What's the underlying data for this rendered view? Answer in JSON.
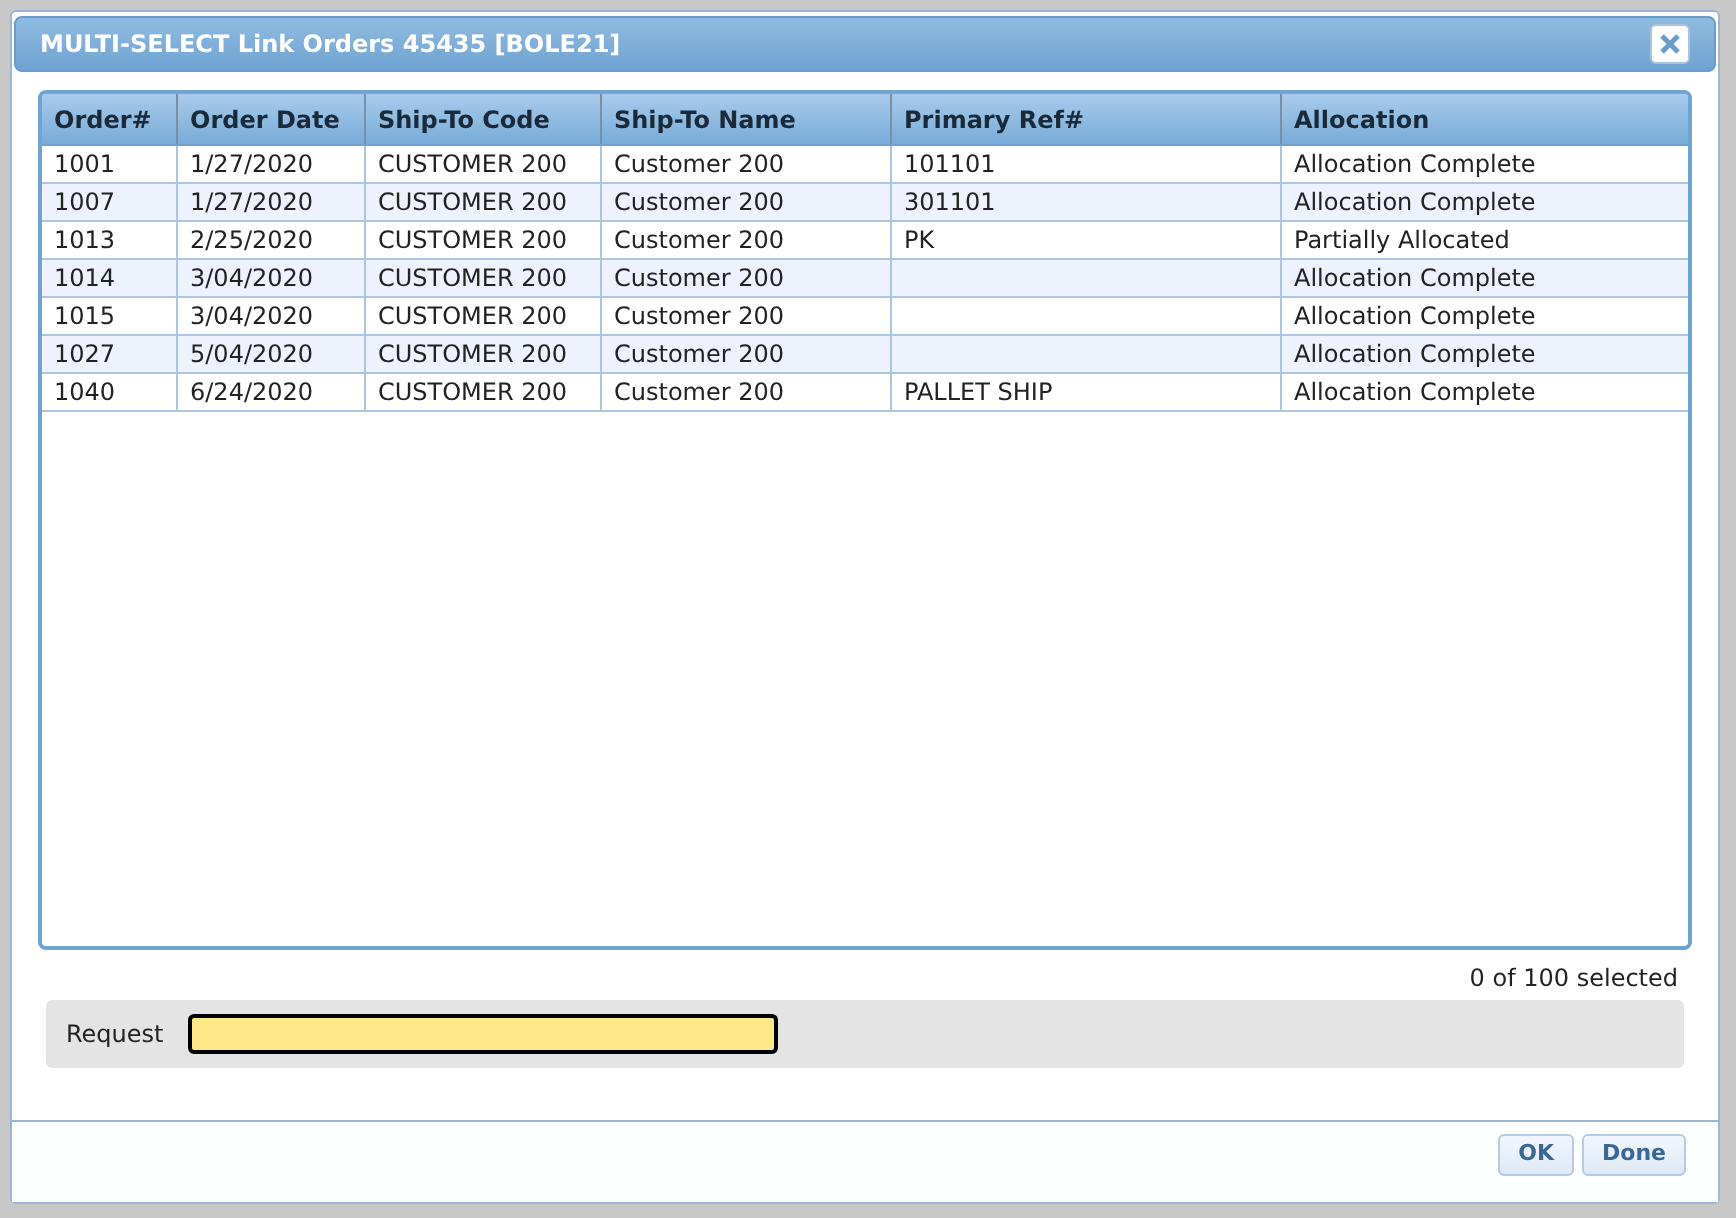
{
  "dialog": {
    "title": "MULTI-SELECT Link Orders 45435 [BOLE21]"
  },
  "table": {
    "columns": [
      "Order#",
      "Order Date",
      "Ship-To Code",
      "Ship-To Name",
      "Primary Ref#",
      "Allocation"
    ],
    "rows": [
      [
        "1001",
        "1/27/2020",
        "CUSTOMER 200",
        "Customer 200",
        "101101",
        "Allocation Complete"
      ],
      [
        "1007",
        "1/27/2020",
        "CUSTOMER 200",
        "Customer 200",
        "301101",
        "Allocation Complete"
      ],
      [
        "1013",
        "2/25/2020",
        "CUSTOMER 200",
        "Customer 200",
        "PK",
        "Partially Allocated"
      ],
      [
        "1014",
        "3/04/2020",
        "CUSTOMER 200",
        "Customer 200",
        "",
        "Allocation Complete"
      ],
      [
        "1015",
        "3/04/2020",
        "CUSTOMER 200",
        "Customer 200",
        "",
        "Allocation Complete"
      ],
      [
        "1027",
        "5/04/2020",
        "CUSTOMER 200",
        "Customer 200",
        "",
        "Allocation Complete"
      ],
      [
        "1040",
        "6/24/2020",
        "CUSTOMER 200",
        "Customer 200",
        "PALLET SHIP",
        "Allocation Complete"
      ]
    ]
  },
  "selection_count": "0 of 100 selected",
  "request": {
    "label": "Request"
  },
  "buttons": [
    "OK",
    "Done"
  ]
}
